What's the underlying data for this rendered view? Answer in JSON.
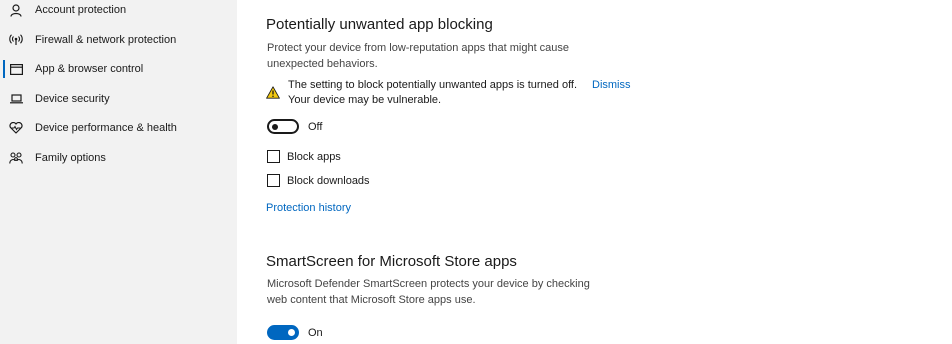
{
  "sidebar": {
    "items": [
      {
        "label": "Account protection",
        "icon": "person-icon"
      },
      {
        "label": "Firewall & network protection",
        "icon": "wireless-icon"
      },
      {
        "label": "App & browser control",
        "icon": "browser-window-icon",
        "selected": true
      },
      {
        "label": "Device security",
        "icon": "laptop-icon"
      },
      {
        "label": "Device performance & health",
        "icon": "heart-icon"
      },
      {
        "label": "Family options",
        "icon": "family-icon"
      }
    ]
  },
  "pua": {
    "title": "Potentially unwanted app blocking",
    "description": "Protect your device from low-reputation apps that might cause unexpected behaviors.",
    "warning_line1": "The setting to block potentially unwanted apps is turned off.",
    "warning_line2": "Your device may be vulnerable.",
    "dismiss_label": "Dismiss",
    "toggle_label": "Off",
    "toggle_on": false,
    "block_apps_label": "Block apps",
    "block_apps_checked": false,
    "block_downloads_label": "Block downloads",
    "block_downloads_checked": false,
    "history_link": "Protection history"
  },
  "smartscreen": {
    "title": "SmartScreen for Microsoft Store apps",
    "description": "Microsoft Defender SmartScreen protects your device by checking web content that Microsoft Store apps use.",
    "toggle_label": "On",
    "toggle_on": true
  },
  "colors": {
    "accent": "#0067c0",
    "warning": "#f2c811",
    "sidebar_bg": "#f2f2f2"
  }
}
